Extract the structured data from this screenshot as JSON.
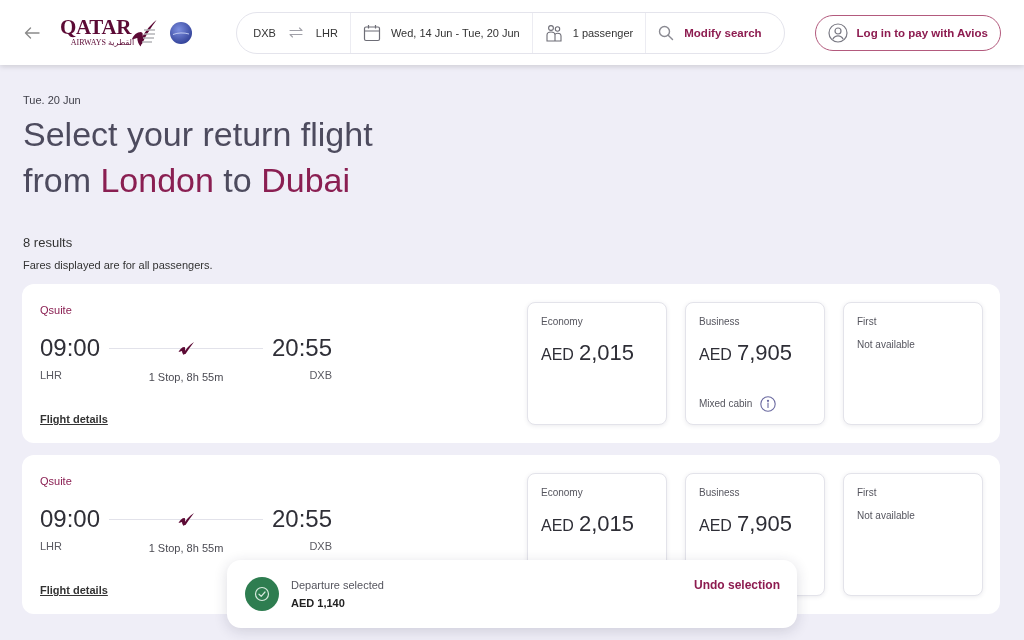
{
  "header": {
    "logo": {
      "wordmark": "QATAR",
      "subtitle": "AIRWAYS",
      "arabic": "القطرية"
    },
    "search": {
      "origin": "DXB",
      "destination": "LHR",
      "dates": "Wed, 14 Jun - Tue, 20 Jun",
      "passengers": "1 passenger",
      "action": "Modify search"
    },
    "login_button": "Log in to pay with Avios"
  },
  "date": "Tue. 20 Jun",
  "heading": [
    {
      "text": "Select your return flight from ",
      "highlight": false
    },
    {
      "text": "London",
      "highlight": true
    },
    {
      "text": " to ",
      "highlight": false
    },
    {
      "text": "Dubai",
      "highlight": true
    }
  ],
  "results_count": "8 results",
  "fares_note": "Fares displayed are for all passengers.",
  "flights": [
    {
      "product": "Qsuite",
      "departure_time": "09:00",
      "departure_airport": "LHR",
      "stops": "1 Stop, 8h 55m",
      "arrival_time": "20:55",
      "arrival_airport": "DXB",
      "details_link": "Flight details",
      "fares": [
        {
          "cabin": "Economy",
          "kind": "price",
          "currency": "AED",
          "amount": "2,015"
        },
        {
          "cabin": "Business",
          "kind": "price",
          "currency": "AED",
          "amount": "7,905",
          "note": "Mixed cabin"
        },
        {
          "cabin": "First",
          "kind": "unavailable",
          "message": "Not available"
        }
      ]
    },
    {
      "product": "Qsuite",
      "departure_time": "09:00",
      "departure_airport": "LHR",
      "stops": "1 Stop, 8h 55m",
      "arrival_time": "20:55",
      "arrival_airport": "DXB",
      "details_link": "Flight details",
      "fares": [
        {
          "cabin": "Economy",
          "kind": "price",
          "currency": "AED",
          "amount": "2,015"
        },
        {
          "cabin": "Business",
          "kind": "price",
          "currency": "AED",
          "amount": "7,905"
        },
        {
          "cabin": "First",
          "kind": "unavailable",
          "message": "Not available"
        }
      ]
    }
  ],
  "toast": {
    "title": "Departure selected",
    "price": "AED 1,140",
    "action": "Undo selection"
  }
}
